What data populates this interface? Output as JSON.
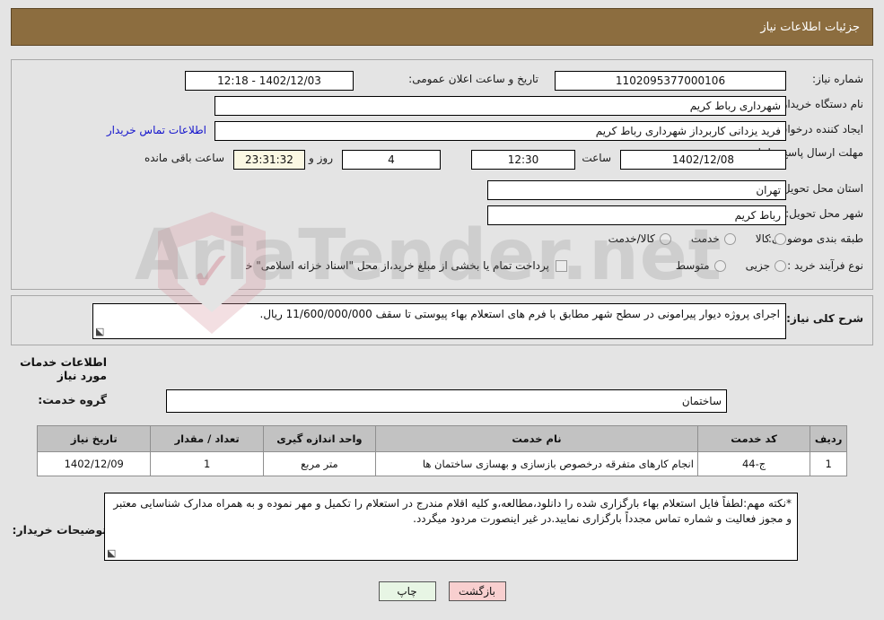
{
  "header": {
    "title": "جزئیات اطلاعات نیاز"
  },
  "watermark": {
    "text": "AriaTender.net",
    "shield_icon": "shield-check-icon",
    "check_glyph": "✓"
  },
  "top_panel": {
    "need_number": {
      "label": "شماره نیاز:",
      "value": "1102095377000106"
    },
    "announce_datetime": {
      "label": "تاریخ و ساعت اعلان عمومی:",
      "value": "1402/12/03 - 12:18"
    },
    "buyer_org": {
      "label": "نام دستگاه خریدار:",
      "value": "شهرداری رباط کریم"
    },
    "request_creator": {
      "label": "ایجاد کننده درخواست:",
      "value": "فرید یزدانی کاربرداز شهرداری رباط کریم"
    },
    "contact_link": {
      "label": "اطلاعات تماس خریدار"
    },
    "deadline": {
      "label": "مهلت ارسال پاسخ: تا تاریخ:",
      "date": "1402/12/08",
      "time_label": "ساعت",
      "time": "12:30",
      "days": "4",
      "days_label": "روز و",
      "countdown": "23:31:32",
      "remaining_label": "ساعت باقی مانده"
    },
    "province": {
      "label": "استان محل تحویل:",
      "value": "تهران"
    },
    "city": {
      "label": "شهر محل تحویل:",
      "value": "رباط کریم"
    },
    "classification": {
      "label": "طبقه بندی موضوعی:",
      "options": [
        {
          "text": "کالا",
          "selected": false
        },
        {
          "text": "خدمت",
          "selected": false
        },
        {
          "text": "کالا/خدمت",
          "selected": false
        }
      ]
    },
    "purchase_type": {
      "label": "نوع فرآیند خرید :",
      "options": [
        {
          "text": "جزیی",
          "selected": false
        },
        {
          "text": "متوسط",
          "selected": false
        }
      ],
      "checkbox_label": "پرداخت تمام یا بخشی از مبلغ خرید،از محل \"اسناد خزانه اسلامی\" خواهد بود.",
      "checkbox_checked": false
    }
  },
  "description": {
    "label": "شرح کلی نیاز:",
    "value": "اجرای پروژه دیوار پیرامونی در سطح شهر مطابق با فرم های استعلام بهاء پیوستی تا سقف 11/600/000/000 ریال."
  },
  "services_section": {
    "title": "اطلاعات خدمات مورد نیاز",
    "group_label": "گروه خدمت:",
    "group_value": "ساختمان"
  },
  "table": {
    "headers": [
      "ردیف",
      "کد خدمت",
      "نام خدمت",
      "واحد اندازه گیری",
      "تعداد / مقدار",
      "تاریخ نیاز"
    ],
    "rows": [
      {
        "index": "1",
        "code": "ج-44",
        "name": "انجام کارهای متفرقه درخصوص بازسازی و بهسازی ساختمان ها",
        "unit": "متر مربع",
        "quantity": "1",
        "need_date": "1402/12/09"
      }
    ]
  },
  "buyer_notes": {
    "label": "توضیحات خریدار:",
    "value": "*نکته مهم:لطفاً فایل استعلام بهاء بارگزاری شده را دانلود،مطالعه،و کلیه اقلام مندرج در استعلام را تکمیل و مهر نموده و به همراه مدارک شناسایی معتبر و مجوز فعالیت و شماره تماس مجدداً بارگزاری نمایید.در غیر اینصورت مردود میگردد."
  },
  "footer": {
    "print_label": "چاپ",
    "back_label": "بازگشت"
  },
  "colors": {
    "header_bar": "#8c6d3f",
    "page_bg": "#e4e4e4",
    "table_header": "#c2c2c2",
    "link": "#1414cc",
    "countdown_bg": "#fbf8e3",
    "print_btn": "#e7f5e4",
    "back_btn": "#f8cfcf"
  }
}
